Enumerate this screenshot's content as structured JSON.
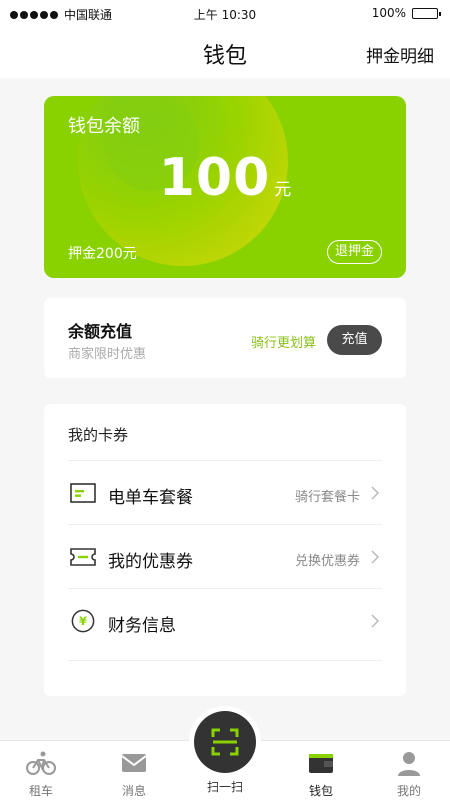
{
  "status_bar": {
    "carrier": "中国联通",
    "time": "上午 10:30",
    "battery": "100%",
    "battery_level": 1.0
  },
  "nav": {
    "title": "钱包",
    "right_label": "押金明细"
  },
  "balance": {
    "label": "钱包余额",
    "amount": "100",
    "unit": "元",
    "deposit": "押金200元",
    "refund_label": "退押金"
  },
  "recharge": {
    "title": "余额充值",
    "subtitle": "商家限时优惠",
    "promo": "骑行更划算",
    "button": "充值"
  },
  "cards": {
    "title": "我的卡券",
    "items": [
      {
        "label": "电单车套餐",
        "hint": "骑行套餐卡",
        "icon": "card-icon"
      },
      {
        "label": "我的优惠券",
        "hint": "兑换优惠券",
        "icon": "coupon-icon"
      },
      {
        "label": "财务信息",
        "hint": "",
        "icon": "yuan-icon"
      }
    ]
  },
  "tabbar": {
    "tabs": [
      {
        "label": "租车",
        "icon": "bike-icon"
      },
      {
        "label": "消息",
        "icon": "mail-icon"
      },
      {
        "label": "扫一扫",
        "icon": "scan-icon"
      },
      {
        "label": "钱包",
        "icon": "wallet-icon"
      },
      {
        "label": "我的",
        "icon": "user-icon"
      }
    ]
  },
  "colors": {
    "accent": "#89d200",
    "promo": "#8abf1a",
    "dark_button": "#4a4a4a"
  }
}
